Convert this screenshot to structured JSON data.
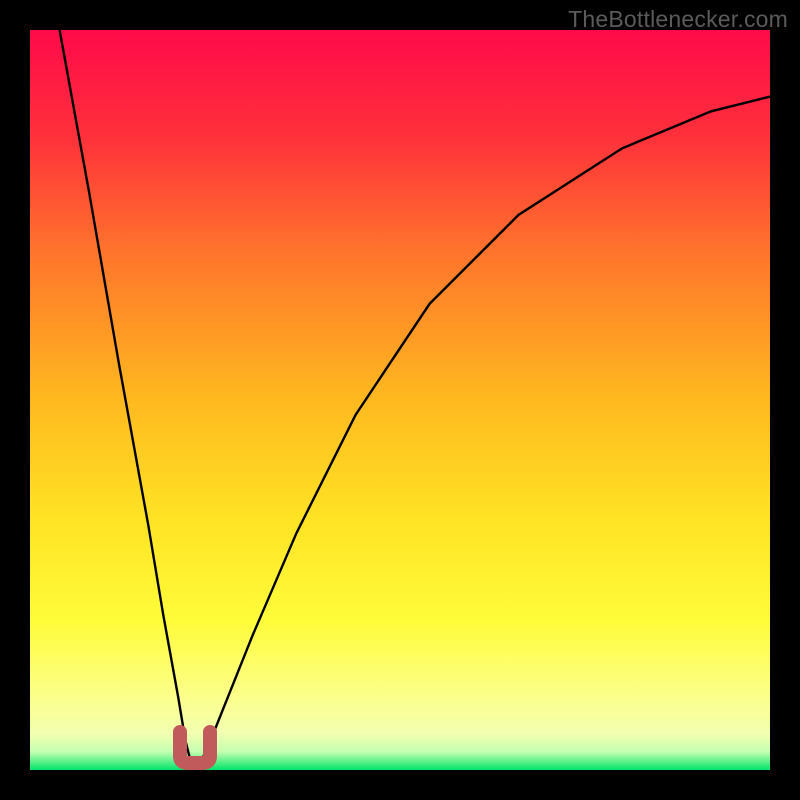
{
  "watermark": "TheBottlenecker.com",
  "chart_data": {
    "type": "line",
    "title": "",
    "xlabel": "",
    "ylabel": "",
    "xlim": [
      0,
      100
    ],
    "ylim": [
      0,
      100
    ],
    "grid": false,
    "legend": false,
    "background_gradient": {
      "top_color": "#ff0a4a",
      "mid_colors": [
        "#ff6e2d",
        "#ffd21e",
        "#fffe34",
        "#fdff90"
      ],
      "bottom_color": "#00e56a"
    },
    "optimum_x": 22,
    "series": [
      {
        "name": "bottleneck-curve",
        "description": "Estimated absolute bottleneck percentage as x varies; 0 at optimum, rises steeply left, rises and saturates right.",
        "x": [
          4,
          8,
          12,
          16,
          18,
          20,
          21,
          22,
          23,
          24,
          26,
          30,
          36,
          44,
          54,
          66,
          80,
          92,
          100
        ],
        "values": [
          100,
          78,
          55,
          33,
          21,
          10,
          4,
          0,
          1,
          3,
          8,
          18,
          32,
          48,
          63,
          75,
          84,
          89,
          91
        ]
      }
    ],
    "minimum_marker": {
      "shape": "u",
      "color": "#c15a5a",
      "x": 22,
      "y": 1.5,
      "width": 4,
      "height": 4
    }
  }
}
